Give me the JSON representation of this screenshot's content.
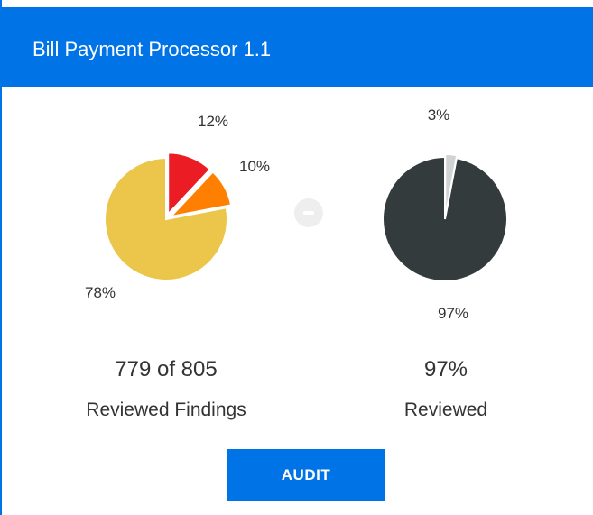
{
  "header": {
    "title": "Bill Payment Processor 1.1"
  },
  "colors": {
    "header_bg": "#0073e6",
    "button_bg": "#0073e6",
    "red": "#ec1c24",
    "orange": "#ff7f00",
    "yellow": "#ecc64a",
    "dark": "#333b3d",
    "light_gray": "#cfd3d3"
  },
  "chart_data": [
    {
      "type": "pie",
      "slices": [
        {
          "label": "12%",
          "value": 12,
          "color": "#ec1c24"
        },
        {
          "label": "10%",
          "value": 10,
          "color": "#ff7f00"
        },
        {
          "label": "78%",
          "value": 78,
          "color": "#ecc64a"
        }
      ]
    },
    {
      "type": "pie",
      "slices": [
        {
          "label": "3%",
          "value": 3,
          "color": "#cfd3d3"
        },
        {
          "label": "97%",
          "value": 97,
          "color": "#333b3d"
        }
      ]
    }
  ],
  "left_summary": {
    "value": "779 of 805",
    "caption": "Reviewed Findings"
  },
  "right_summary": {
    "value": "97%",
    "caption": "Reviewed"
  },
  "separator_icon": "minus-circle-icon",
  "audit_button": {
    "label": "AUDIT"
  }
}
